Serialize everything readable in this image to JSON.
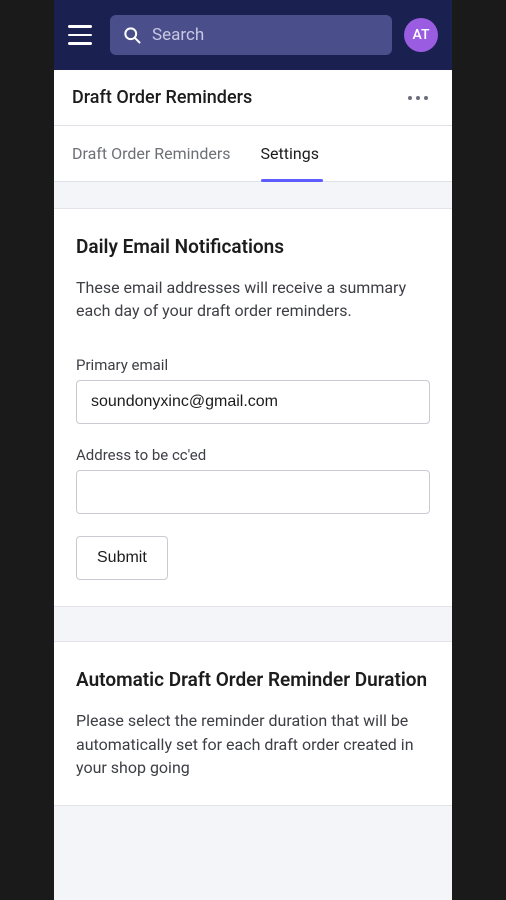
{
  "topbar": {
    "search_placeholder": "Search",
    "avatar_initials": "AT"
  },
  "page": {
    "title": "Draft Order Reminders"
  },
  "tabs": [
    {
      "label": "Draft Order Reminders",
      "active": false
    },
    {
      "label": "Settings",
      "active": true
    }
  ],
  "sections": {
    "daily_email": {
      "heading": "Daily Email Notifications",
      "description": "These email addresses will receive a summary each day of your draft order reminders.",
      "primary_label": "Primary email",
      "primary_value": "soundonyxinc@gmail.com",
      "cc_label": "Address to be cc'ed",
      "cc_value": "",
      "submit_label": "Submit"
    },
    "auto_duration": {
      "heading": "Automatic Draft Order Reminder Duration",
      "description": "Please select the reminder duration that will be automatically set for each draft order created in your shop going"
    }
  },
  "colors": {
    "topbar_bg": "#1a2150",
    "search_bg": "#4a4e8a",
    "avatar_bg": "#9a5ce0",
    "accent": "#5c5cff"
  }
}
